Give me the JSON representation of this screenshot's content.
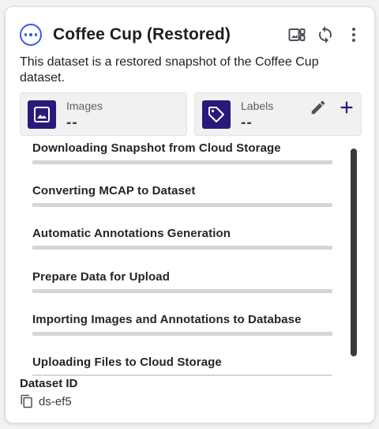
{
  "card": {
    "title": "Coffee Cup (Restored)",
    "description": "This dataset is a restored snapshot of the Coffee Cup dataset.",
    "status_icon": "more-horizontal-circle-icon",
    "actions": [
      "gallery-view-icon",
      "sync-icon",
      "more-vertical-icon"
    ]
  },
  "stats": {
    "images": {
      "label": "Images",
      "value": "--",
      "icon": "image-icon"
    },
    "labels": {
      "label": "Labels",
      "value": "--",
      "icon": "tag-icon",
      "actions": [
        "edit-icon",
        "add-icon"
      ]
    }
  },
  "progress": {
    "items": [
      {
        "label": "Downloading Snapshot from Cloud Storage",
        "progress": 0
      },
      {
        "label": "Converting MCAP to Dataset",
        "progress": 0
      },
      {
        "label": "Automatic Annotations Generation",
        "progress": 0
      },
      {
        "label": "Prepare Data for Upload",
        "progress": 0
      },
      {
        "label": "Importing Images and Annotations to Database",
        "progress": 0
      },
      {
        "label": "Uploading Files to Cloud Storage",
        "progress": 0
      }
    ]
  },
  "dataset_id": {
    "label": "Dataset ID",
    "value": "ds-ef5",
    "icon": "copy-icon"
  },
  "colors": {
    "accent": "#3f58e6",
    "stat_icon_bg": "#2a197b",
    "track": "#d4d6db"
  }
}
